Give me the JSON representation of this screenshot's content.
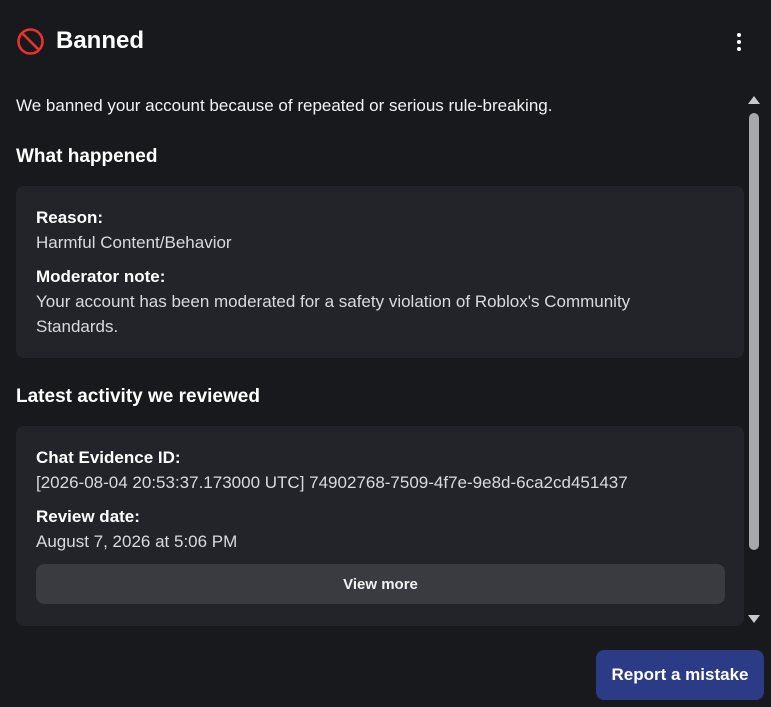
{
  "header": {
    "title": "Banned",
    "status_icon": "ban-icon",
    "menu_icon": "more-vertical-icon",
    "accent_color": "#e8322f"
  },
  "intro": "We banned your account because of repeated or serious rule-breaking.",
  "what_happened": {
    "title": "What happened",
    "reason_label": "Reason:",
    "reason_value": "Harmful Content/Behavior",
    "note_label": "Moderator note:",
    "note_value": "Your account has been moderated for a safety violation of Roblox's Community Standards."
  },
  "latest_activity": {
    "title": "Latest activity we reviewed",
    "evidence_label": "Chat Evidence ID:",
    "evidence_value": "[2026-08-04 20:53:37.173000 UTC] 74902768-7509-4f7e-9e8d-6ca2cd451437",
    "review_label": "Review date:",
    "review_value": "August 7, 2026 at 5:06 PM",
    "view_more_label": "View more"
  },
  "footer": {
    "report_label": "Report a mistake",
    "report_color": "#2b3b86"
  }
}
